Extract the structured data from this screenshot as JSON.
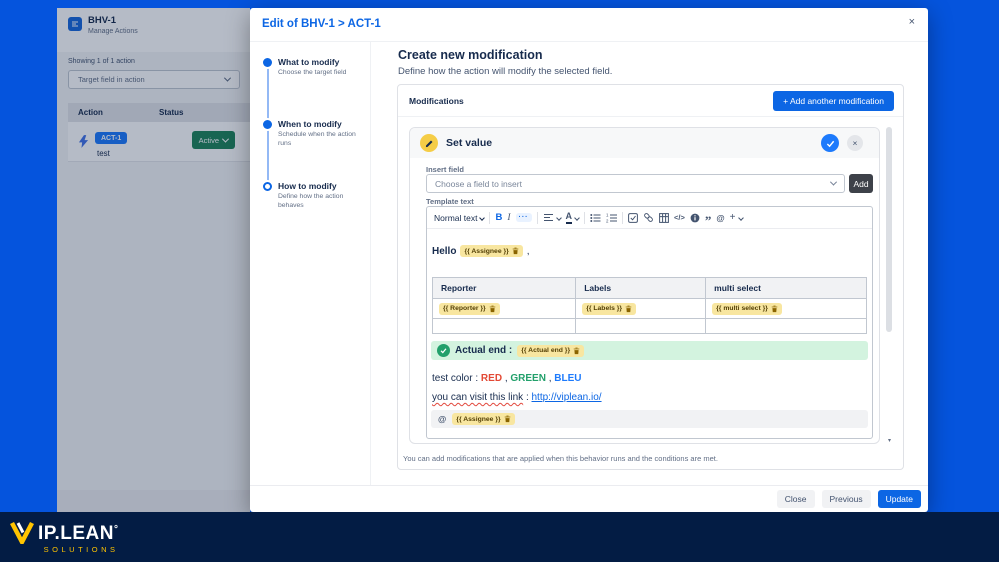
{
  "backdrop": {
    "app_title": "BHV-1",
    "app_subtitle": "Manage Actions",
    "showing_text": "Showing 1 of 1 action",
    "filter_label": "Target field in action",
    "table_headers": [
      "Action",
      "Status"
    ],
    "row": {
      "tag": "ACT-1",
      "name": "test",
      "status_label": "Active"
    }
  },
  "modal": {
    "title": "Edit of BHV-1 > ACT-1",
    "stepper": [
      {
        "title": "What to modify",
        "subtitle": "Choose the target field"
      },
      {
        "title": "When to modify",
        "subtitle": "Schedule when the action runs"
      },
      {
        "title": "How to modify",
        "subtitle": "Define how the action behaves"
      }
    ],
    "heading": "Create new modification",
    "subheading": "Define how the action will modify the selected field.",
    "card": {
      "title": "Modifications",
      "add_button_label": "+ Add another modification",
      "footnote": "You can add modifications that are applied when this behavior runs and the conditions are met."
    },
    "panel": {
      "title": "Set value",
      "insert_field_label": "Insert field",
      "insert_placeholder": "Choose a field to insert",
      "add_label": "Add",
      "template_label": "Template text"
    },
    "toolbar": {
      "style_label": "Normal text"
    },
    "editor": {
      "hello": "Hello",
      "comma": ",",
      "chip_assignee": "{{ Assignee }}",
      "chip_reporter": "{{ Reporter }}",
      "chip_labels": "{{ Labels }}",
      "chip_multi": "{{ multi select }}",
      "chip_actual_end": "{{ Actual end }}",
      "table_headers": [
        "Reporter",
        "Labels",
        "multi select"
      ],
      "actual_end_label": "Actual end :",
      "color_prefix": "test color :",
      "color_red": "RED",
      "comma1": ",",
      "color_green": "GREEN",
      "comma2": ",",
      "color_blue": "BLEU",
      "link_prefix": "you can visit this link",
      "link_colon": ":",
      "link_url": "http://viplean.io/"
    },
    "footer": {
      "close": "Close",
      "previous": "Previous",
      "update": "Update"
    }
  },
  "icons": {
    "close": "×",
    "bold": "B",
    "italic": "I",
    "more": "···",
    "color_letter": "A",
    "code": "</>",
    "quote": "”",
    "mention": "@",
    "plus": "+",
    "scroll_down": "▾"
  },
  "branding": {
    "wordmark": "IP.LEAN",
    "degree": "°",
    "tagline": "SOLUTIONS"
  },
  "colors": {
    "accent": "#0C66E4",
    "success": "#22A06B",
    "chip_bg": "#F8E6A0",
    "background_blue": "#0554DD",
    "footer_navy": "#031C44"
  }
}
